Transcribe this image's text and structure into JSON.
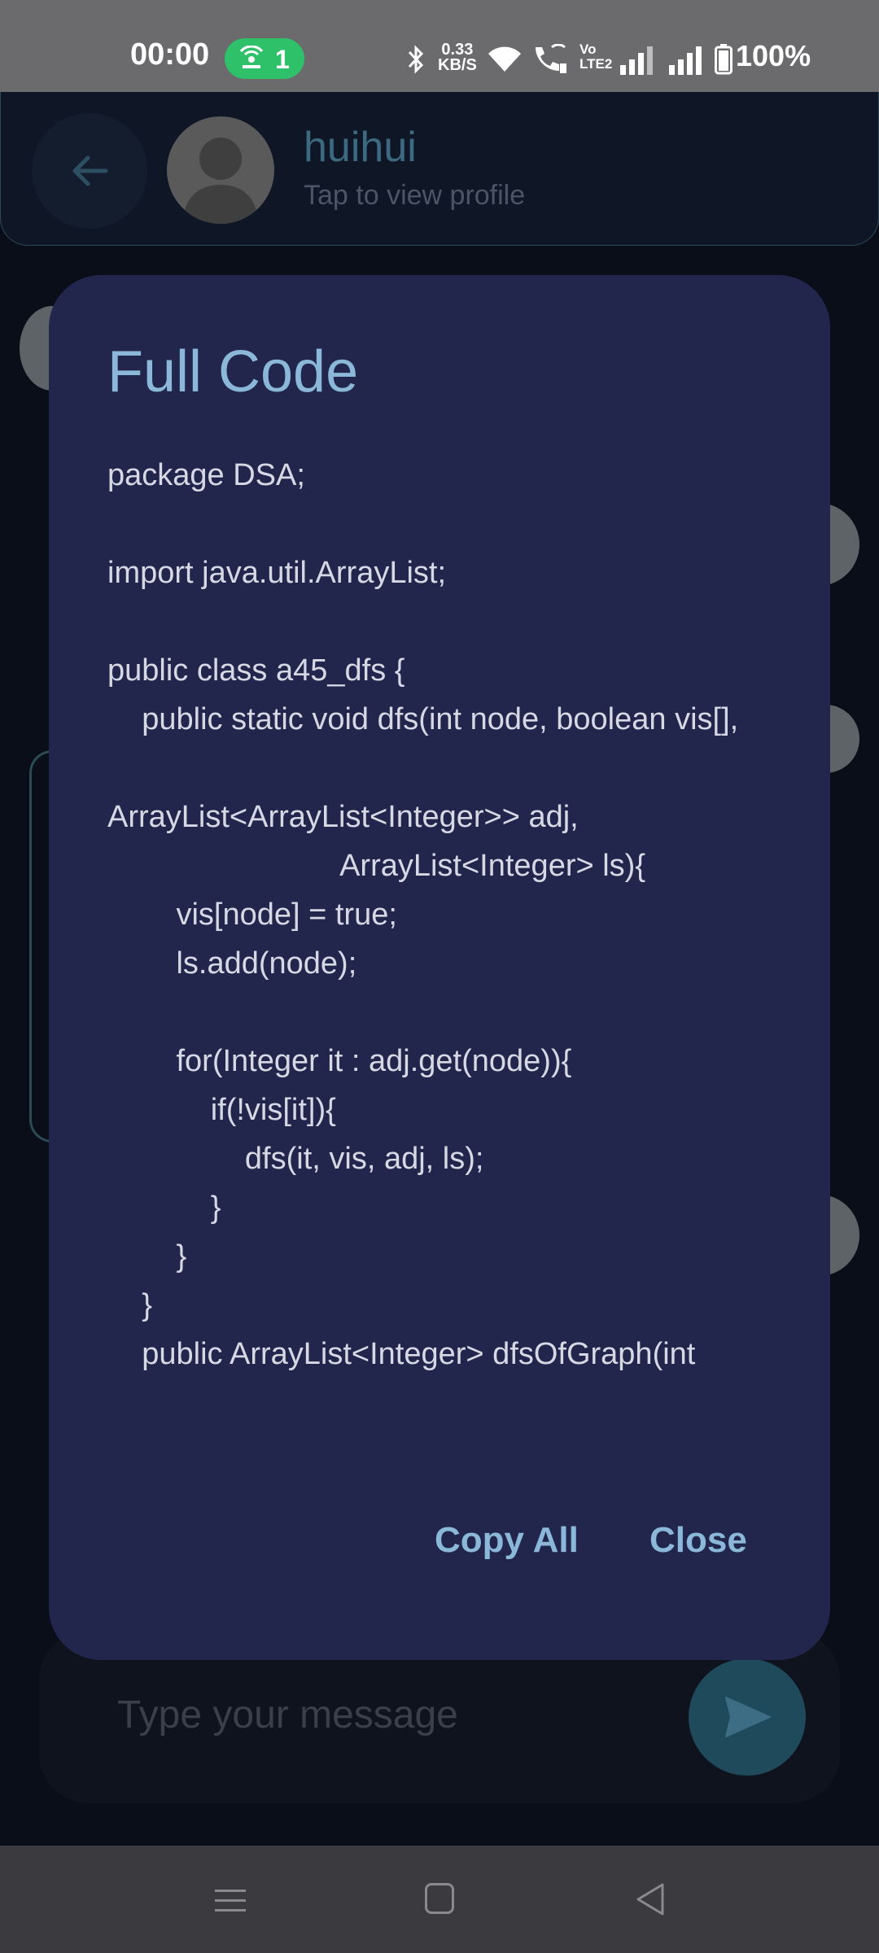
{
  "status_bar": {
    "time": "00:00",
    "hotspot_count": "1",
    "net_speed_value": "0.33",
    "net_speed_unit": "KB/S",
    "volte_label_top": "Vo",
    "volte_label_bottom": "LTE2",
    "battery": "100%"
  },
  "header": {
    "contact_name": "huihui",
    "subtitle": "Tap to view profile"
  },
  "dialog": {
    "title": "Full Code",
    "code": "package DSA;\n\nimport java.util.ArrayList;\n\npublic class a45_dfs {\n    public static void dfs(int node, boolean vis[],\n\nArrayList<ArrayList<Integer>> adj,\n                           ArrayList<Integer> ls){\n        vis[node] = true;\n        ls.add(node);\n\n        for(Integer it : adj.get(node)){\n            if(!vis[it]){\n                dfs(it, vis, adj, ls);\n            }\n        }\n    }\n    public ArrayList<Integer> dfsOfGraph(int",
    "copy_all_label": "Copy All",
    "close_label": "Close"
  },
  "composer": {
    "placeholder": "Type your message"
  },
  "colors": {
    "accent": "#8bb8d8",
    "dialog_bg": "#23264c",
    "hotspot_green": "#2fc06a"
  }
}
